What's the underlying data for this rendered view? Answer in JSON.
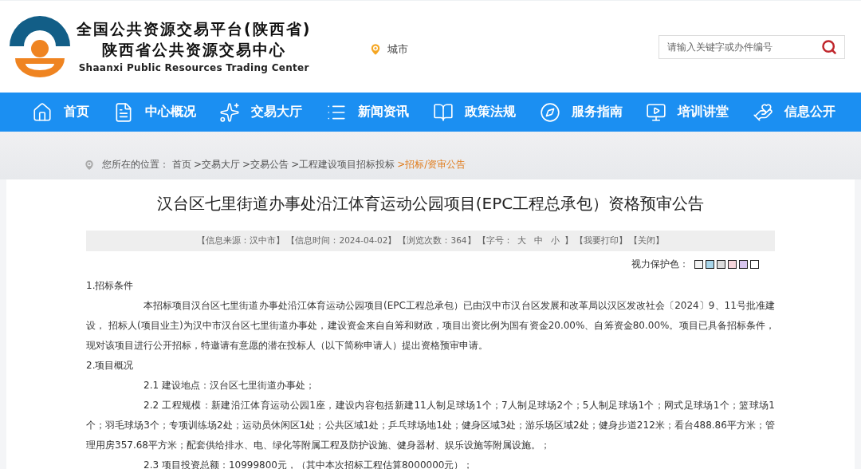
{
  "header": {
    "title_cn": "全国公共资源交易平台(陕西省)",
    "subtitle_cn": "陕西省公共资源交易中心",
    "title_en": "Shaanxi Public Resources Trading Center",
    "city": "城市",
    "search": {
      "placeholder": "请输入关键字或办件编号"
    }
  },
  "nav": [
    {
      "label": "首页"
    },
    {
      "label": "中心概况"
    },
    {
      "label": "交易大厅"
    },
    {
      "label": "新闻资讯"
    },
    {
      "label": "政策法规"
    },
    {
      "label": "服务指南"
    },
    {
      "label": "培训讲堂"
    },
    {
      "label": "信息公开"
    }
  ],
  "breadcrumb": {
    "label": "您所在的位置：",
    "items": [
      {
        "text": "首页",
        "current": false
      },
      {
        "text": ">交易大厅",
        "current": false
      },
      {
        "text": ">交易公告",
        "current": false
      },
      {
        "text": ">工程建设项目招标投标",
        "current": false
      },
      {
        "text": ">招标/资审公告",
        "current": true
      }
    ]
  },
  "article": {
    "title": "汉台区七里街道办事处沿江体育运动公园项目(EPC工程总承包）资格预审公告",
    "info": [
      {
        "kind": "text",
        "text": "【信息来源：汉中市】"
      },
      {
        "kind": "text",
        "text": "【信息时间：2024-04-02】"
      },
      {
        "kind": "text",
        "text": "【浏览次数：364】"
      },
      {
        "kind": "font-size",
        "prefix": "【字号：",
        "sizes": [
          "大",
          "中",
          "小"
        ],
        "suffix": "】"
      },
      {
        "kind": "link",
        "text": "【我要打印】"
      },
      {
        "kind": "link",
        "text": "【关闭】"
      }
    ],
    "eye_care": {
      "label": "视力保护色：",
      "swatches": [
        {
          "color": "#f3f3f3"
        },
        {
          "color": "#a9d6ea"
        },
        {
          "color": "#dcdcdc"
        },
        {
          "color": "#f6d6dc"
        },
        {
          "color": "#d9c6ef"
        },
        {
          "color": "#ffffff"
        }
      ]
    },
    "body": [
      {
        "kind": "heading",
        "text": "1.招标条件"
      },
      {
        "kind": "paragraph",
        "text": "本招标项目汉台区七里街道办事处沿江体育运动公园项目(EPC工程总承包）已由汉中市汉台区发展和改革局以汉区发改社会〔2024〕9、11号批准建设， 招标人(项目业主)为汉中市汉台区七里街道办事处，建设资金来自自筹和财政，项目出资比例为国有资金20.00%、自筹资金80.00%。项目已具备招标条件，现对该项目进行公开招标，特邀请有意愿的潜在投标人（以下简称申请人）提出资格预审申请。"
      },
      {
        "kind": "heading",
        "text": "2.项目概况"
      },
      {
        "kind": "paragraph",
        "text": "2.1 建设地点：汉台区七里街道办事处；"
      },
      {
        "kind": "paragraph",
        "text": "2.2 工程规模：新建沿江体育运动公园1座，建设内容包括新建11人制足球场1个；7人制足球场2个；5人制足球场1个；网式足球场1个；篮球场1个；羽毛球场3个；专项训练场2处；运动员休闲区1处；公共区域1处；乒乓球场地1处；健身区域3处；游乐场区域2处；健身步道212米；看台488.86平方米；管理用房357.68平方米；配套供给排水、电、绿化等附属工程及防护设施、健身器材、娱乐设施等附属设施。；"
      },
      {
        "kind": "paragraph",
        "text": "2.3 项目投资总额：10999800元，（其中本次招标工程估算8000000元）；"
      }
    ]
  }
}
